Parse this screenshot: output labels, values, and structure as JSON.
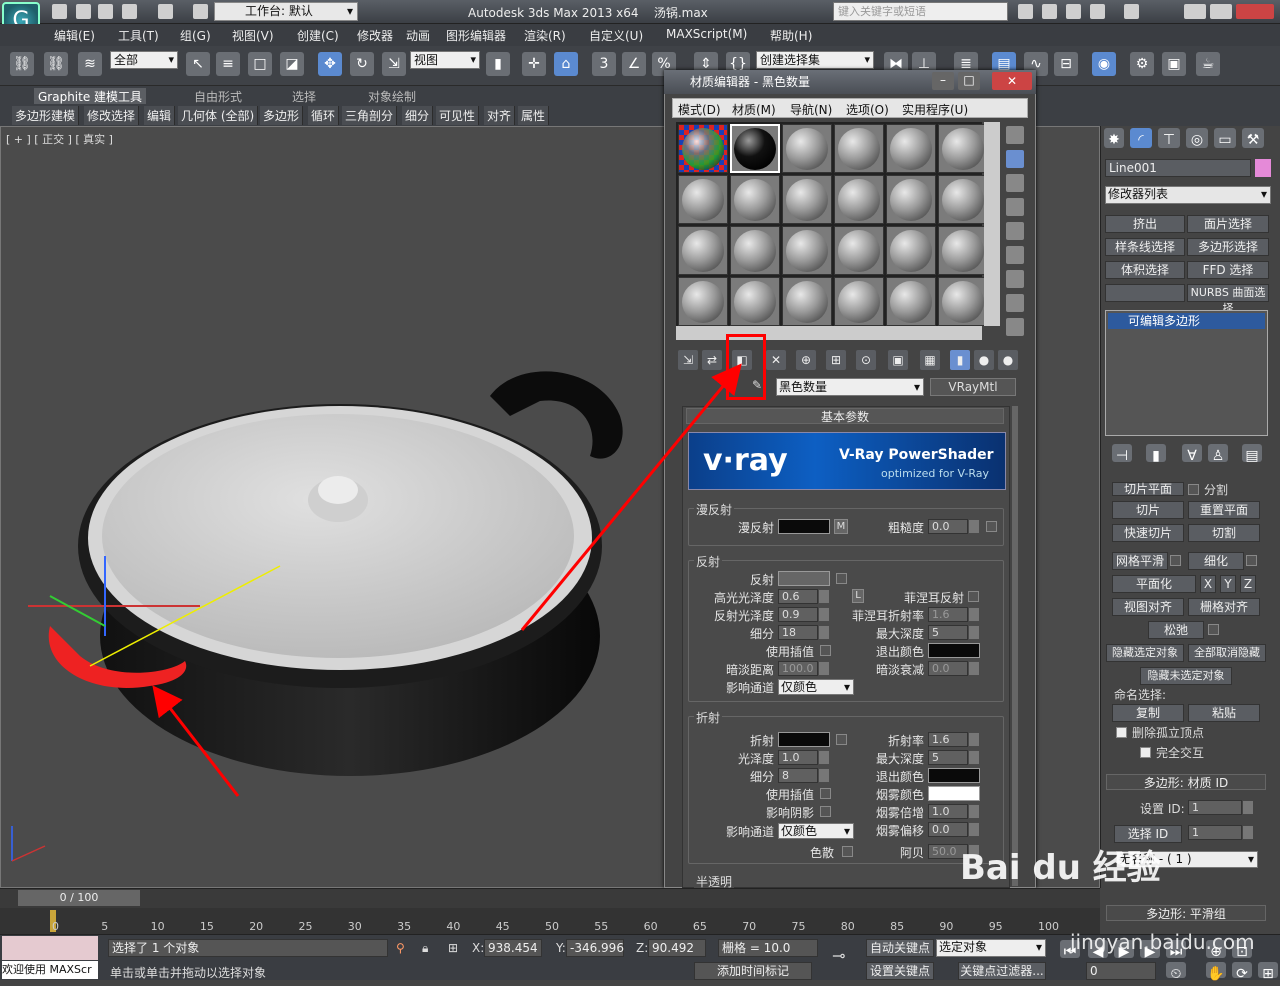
{
  "app": {
    "title": "Autodesk 3ds Max  2013 x64",
    "file": "汤锅.max",
    "workspace": "工作台: 默认",
    "search_placeholder": "键入关键字或短语"
  },
  "menu": [
    "编辑(E)",
    "工具(T)",
    "组(G)",
    "视图(V)",
    "创建(C)",
    "修改器",
    "动画",
    "图形编辑器",
    "渲染(R)",
    "自定义(U)",
    "MAXScript(M)",
    "帮助(H)"
  ],
  "toolbar": {
    "selection_filter": "全部",
    "ref_coord": "视图",
    "named_selection": "创建选择集"
  },
  "ribbon": {
    "tabs": [
      "Graphite 建模工具",
      "自由形式",
      "选择",
      "对象绘制"
    ],
    "subtabs": [
      "多边形建模",
      "修改选择",
      "编辑",
      "几何体 (全部)",
      "多边形",
      "循环",
      "三角剖分",
      "细分",
      "可见性",
      "对齐",
      "属性"
    ]
  },
  "viewport": {
    "label": "[ + ] [ 正交 ] [ 真实 ]"
  },
  "material_editor": {
    "title": "材质编辑器 - 黑色数量",
    "menu": [
      "模式(D)",
      "材质(M)",
      "导航(N)",
      "选项(O)",
      "实用程序(U)"
    ],
    "material_name": "黑色数量",
    "material_type": "VRayMtl",
    "rollout_title": "基本参数",
    "vray_banner": {
      "logo": "v·ray",
      "line1": "V-Ray PowerShader",
      "line2": "optimized for V-Ray"
    },
    "diffuse": {
      "group": "漫反射",
      "diffuse_label": "漫反射",
      "m_btn": "M",
      "roughness_label": "粗糙度",
      "roughness": "0.0"
    },
    "reflection": {
      "group": "反射",
      "reflect_label": "反射",
      "hilight_gloss_label": "高光光泽度",
      "hilight_gloss": "0.6",
      "l_btn": "L",
      "fresnel_label": "菲涅耳反射",
      "refl_gloss_label": "反射光泽度",
      "refl_gloss": "0.9",
      "fresnel_ior_label": "菲涅耳折射率",
      "fresnel_ior": "1.6",
      "subdivs_label": "细分",
      "subdivs": "18",
      "max_depth_label": "最大深度",
      "max_depth": "5",
      "use_interp_label": "使用插值",
      "exit_color_label": "退出颜色",
      "dim_dist_label": "暗淡距离",
      "dim_dist": "100.0",
      "dim_falloff_label": "暗淡衰减",
      "dim_falloff": "0.0",
      "affect_channels_label": "影响通道",
      "affect_channels": "仅颜色"
    },
    "refraction": {
      "group": "折射",
      "refract_label": "折射",
      "ior_label": "折射率",
      "ior": "1.6",
      "gloss_label": "光泽度",
      "gloss": "1.0",
      "max_depth_label": "最大深度",
      "max_depth": "5",
      "subdivs_label": "细分",
      "subdivs": "8",
      "exit_color_label": "退出颜色",
      "use_interp_label": "使用插值",
      "fog_color_label": "烟雾颜色",
      "affect_shadows_label": "影响阴影",
      "fog_mult_label": "烟雾倍增",
      "fog_mult": "1.0",
      "affect_channels_label": "影响通道",
      "affect_channels": "仅颜色",
      "fog_bias_label": "烟雾偏移",
      "fog_bias": "0.0",
      "dispersion_label": "色散",
      "abbe_label": "阿贝",
      "abbe": "50.0"
    },
    "translucency_group": "半透明"
  },
  "command_panel": {
    "object_name": "Line001",
    "modifier_list": "修改器列表",
    "buttons": [
      "挤出",
      "面片选择",
      "样条线选择",
      "多边形选择",
      "体积选择",
      "FFD 选择",
      "NURBS 曲面选择"
    ],
    "stack_item": "可编辑多边形",
    "edit_buttons": [
      "切片平面",
      "分割",
      "切片",
      "重置平面",
      "快速切片",
      "切割",
      "网格平滑",
      "细化",
      "平面化",
      "X",
      "Y",
      "Z",
      "视图对齐",
      "栅格对齐",
      "松弛",
      "隐藏选定对象",
      "全部取消隐藏",
      "隐藏未选定对象"
    ],
    "named_sel_label": "命名选择:",
    "copy": "复制",
    "paste": "粘贴",
    "delete_isolated": "删除孤立顶点",
    "full_interactive": "完全交互",
    "poly_mat_id": "多边形: 材质 ID",
    "set_id_label": "设置 ID:",
    "set_id": "1",
    "select_id_label": "选择 ID",
    "select_id": "1",
    "no_name": "无名称 - ( 1 )",
    "smoothing": "多边形: 平滑组"
  },
  "timeline": {
    "frame": "0 / 100",
    "ticks": [
      "0",
      "5",
      "10",
      "15",
      "20",
      "25",
      "30",
      "35",
      "40",
      "45",
      "50",
      "55",
      "60",
      "65",
      "70",
      "75",
      "80",
      "85",
      "90",
      "95",
      "100"
    ]
  },
  "status": {
    "welcome": "欢迎使用 MAXScr",
    "selected": "选择了 1 个对象",
    "prompt": "单击或单击并拖动以选择对象",
    "x_label": "X:",
    "x": "938.454",
    "y_label": "Y:",
    "y": "-346.996",
    "z_label": "Z:",
    "z": "90.492",
    "grid": "栅格 = 10.0",
    "add_time_tag": "添加时间标记",
    "auto_key": "自动关键点",
    "set_key": "设置关键点",
    "selected_obj": "选定对象",
    "key_filter": "关键点过滤器...",
    "frame_field": "0"
  },
  "watermark": {
    "brand": "Bai du 经验",
    "url": "jingyan.baidu.com"
  },
  "colors": {
    "annotation": "#ff0000",
    "accent": "#2d5a9e"
  }
}
